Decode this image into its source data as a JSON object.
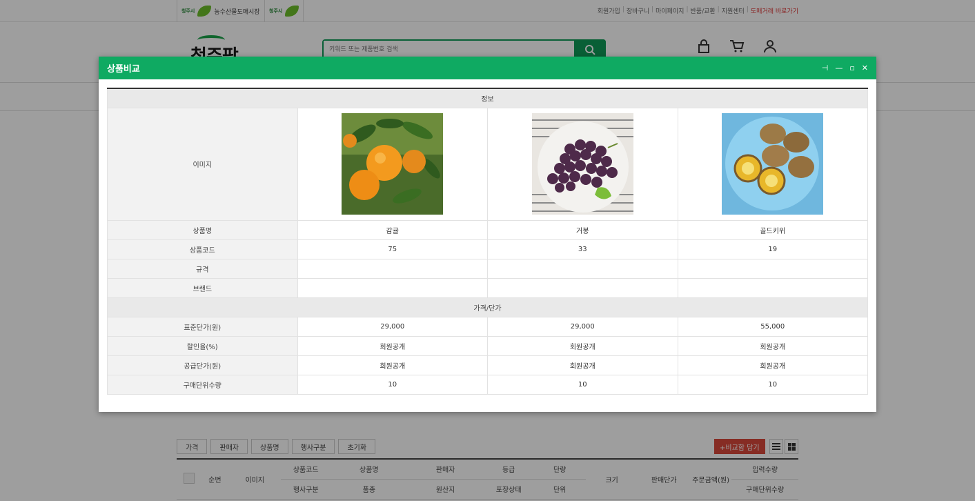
{
  "topbar": {
    "badge1_city": "청주시",
    "badge1_title": "농수산물도매시장",
    "badge2_city": "청주시",
    "links": [
      "회원가입",
      "장바구니",
      "마이페이지",
      "반품/교환",
      "지원센터"
    ],
    "direct_link": "도매거래 바로가기"
  },
  "header": {
    "logo": "청주팜",
    "search_placeholder": "키워드 또는 제품번호 검색"
  },
  "modal": {
    "title": "상품비교",
    "section_info": "정보",
    "section_price": "가격/단가",
    "labels": {
      "image": "이미지",
      "name": "상품명",
      "code": "상품코드",
      "spec": "규격",
      "brand": "브랜드",
      "std_price": "표준단가(원)",
      "discount": "할인율(%)",
      "supply_price": "공급단가(원)",
      "unit_qty": "구매단위수량"
    },
    "products": [
      {
        "name": "감귤",
        "code": "75",
        "spec": "",
        "brand": "",
        "std_price": "29,000",
        "discount": "회원공개",
        "supply_price": "회원공개",
        "unit_qty": "10",
        "image_icon": "tangerine-image"
      },
      {
        "name": "거봉",
        "code": "33",
        "spec": "",
        "brand": "",
        "std_price": "29,000",
        "discount": "회원공개",
        "supply_price": "회원공개",
        "unit_qty": "10",
        "image_icon": "grape-image"
      },
      {
        "name": "골드키위",
        "code": "19",
        "spec": "",
        "brand": "",
        "std_price": "55,000",
        "discount": "회원공개",
        "supply_price": "회원공개",
        "unit_qty": "10",
        "image_icon": "kiwi-image"
      }
    ]
  },
  "filters": [
    "가격",
    "판매자",
    "상품명",
    "행사구분",
    "초기화"
  ],
  "compare_button": "+비교함 담기",
  "list_headers": {
    "seq": "순번",
    "image": "이미지",
    "row1": [
      "상품코드",
      "상품명",
      "판매자",
      "등급",
      "단량"
    ],
    "row2": [
      "행사구분",
      "품종",
      "원산지",
      "포장상태",
      "단위"
    ],
    "size": "크기",
    "sell_price": "판매단가",
    "order_amount": "주문금액(원)",
    "input_qty": "입력수량",
    "unit_qty": "구매단위수량"
  },
  "colors": {
    "green": "#0faa62",
    "red": "#d9473a"
  }
}
